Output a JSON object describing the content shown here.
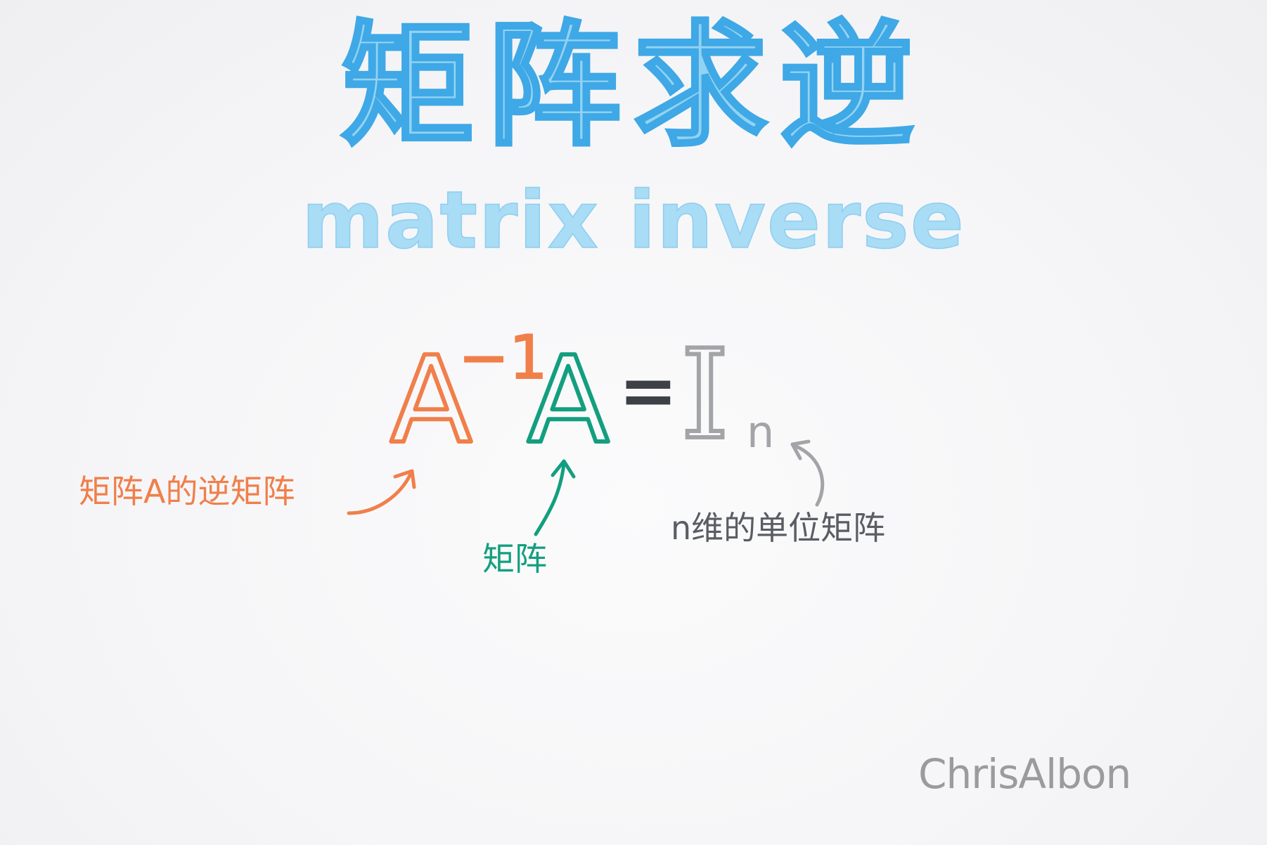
{
  "title": {
    "zh": "矩阵求逆",
    "en": "matrix inverse"
  },
  "equation": {
    "lhs_inverse_base": "A",
    "lhs_inverse_exponent": "−1",
    "lhs_matrix": "A",
    "equals": "=",
    "rhs_identity": "I",
    "rhs_subscript": "n"
  },
  "annotations": {
    "inverse_label": "矩阵A的逆矩阵",
    "matrix_label": "矩阵",
    "identity_label": "n维的单位矩阵"
  },
  "signature": "ChrisAlbon",
  "colors": {
    "title_fill": "#92d3f3",
    "title_stroke": "#3fa8e6",
    "inverse": "#f07f4a",
    "matrix": "#139f7f",
    "equals": "#3e4047",
    "identity": "#a3a4a8",
    "identity_label": "#5a5d64",
    "signature": "#9b9b9b"
  }
}
